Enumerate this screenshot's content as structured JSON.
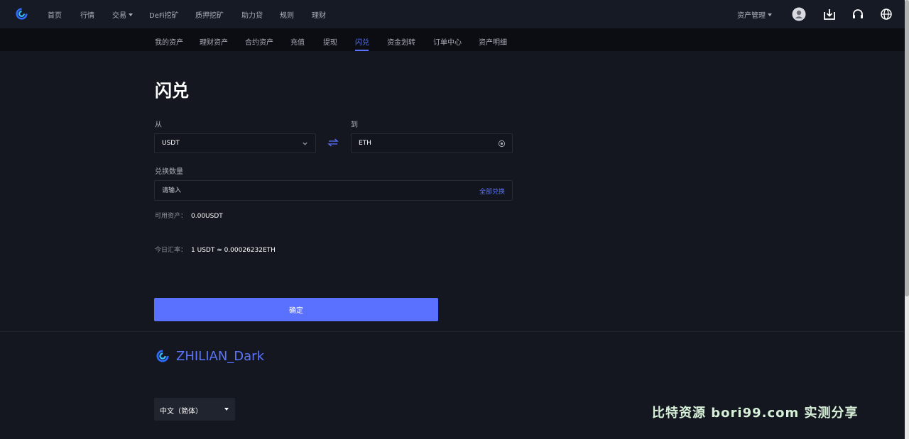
{
  "topnav": {
    "items": [
      "首页",
      "行情",
      "交易",
      "DeFi挖矿",
      "质押挖矿",
      "助力贷",
      "规则",
      "理财"
    ],
    "asset_manage": "资产管理",
    "icons": [
      "user-icon",
      "download-icon",
      "headset-icon",
      "globe-icon"
    ]
  },
  "subnav": {
    "items": [
      "我的资产",
      "理财资产",
      "合约资产",
      "充值",
      "提现",
      "闪兑",
      "资金划转",
      "订单中心",
      "资产明细"
    ],
    "active": "闪兑"
  },
  "page": {
    "title": "闪兑",
    "from_label": "从",
    "from_value": "USDT",
    "to_label": "到",
    "to_value": "ETH",
    "amount_label": "兑换数量",
    "amount_placeholder": "请输入",
    "all_exchange": "全部兑换",
    "available_label": "可用资产：",
    "available_value": "0.00USDT",
    "rate_label": "今日汇率：",
    "rate_value": "1 USDT ≈ 0.00026232ETH",
    "confirm": "确定"
  },
  "footer": {
    "brand": "ZHILIAN_Dark",
    "language": "中文（简体）",
    "watermark": "比特资源 bori99.com 实测分享"
  },
  "colors": {
    "accent": "#5b74ff",
    "background": "#141720",
    "button": "#5a70ff"
  }
}
